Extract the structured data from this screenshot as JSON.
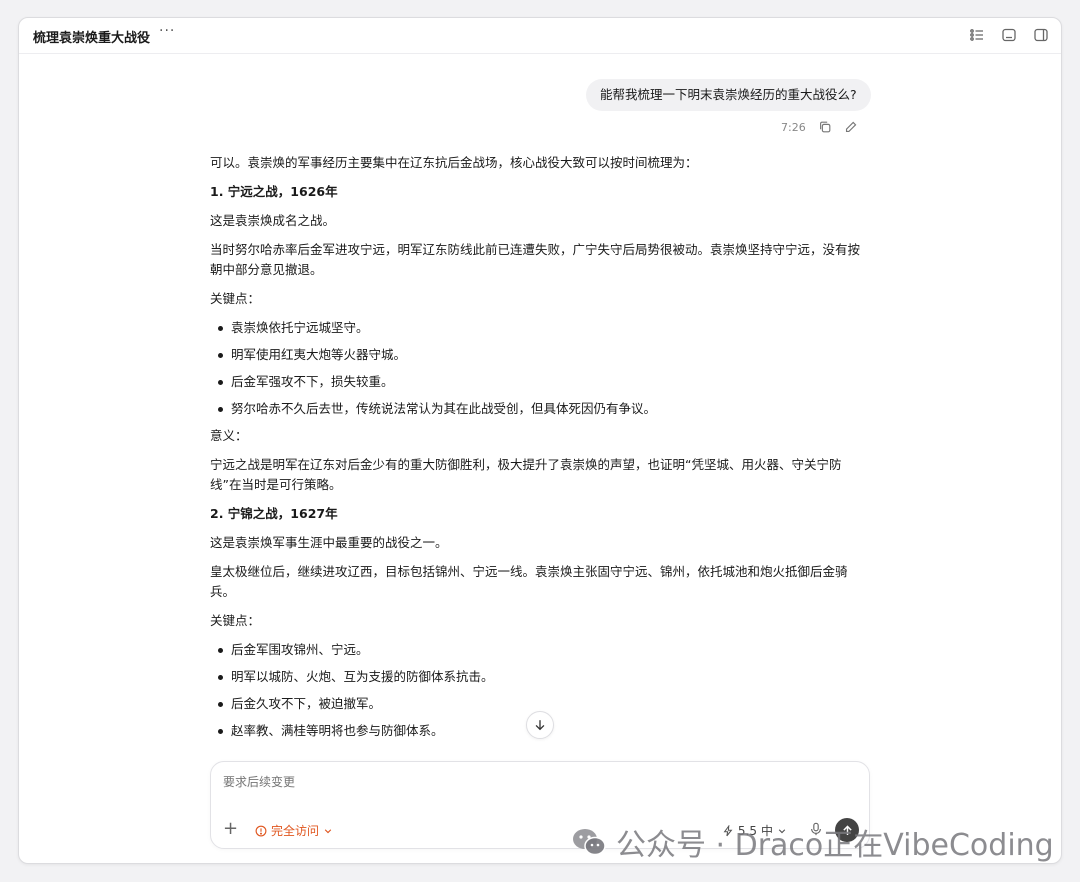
{
  "header": {
    "title": "梳理袁崇焕重大战役",
    "more": "···"
  },
  "user_message": {
    "text": "能帮我梳理一下明末袁崇焕经历的重大战役么?",
    "time": "7:26"
  },
  "answer": {
    "intro": "可以。袁崇焕的军事经历主要集中在辽东抗后金战场，核心战役大致可以按时间梳理为：",
    "battle1_title": "1. 宁远之战，1626年",
    "battle1_lead": "这是袁崇焕成名之战。",
    "battle1_desc": "当时努尔哈赤率后金军进攻宁远，明军辽东防线此前已连遭失败，广宁失守后局势很被动。袁崇焕坚持守宁远，没有按朝中部分意见撤退。",
    "keypoints_label": "关键点：",
    "battle1_points": [
      "袁崇焕依托宁远城坚守。",
      "明军使用红夷大炮等火器守城。",
      "后金军强攻不下，损失较重。",
      "努尔哈赤不久后去世，传统说法常认为其在此战受创，但具体死因仍有争议。"
    ],
    "meaning_label": "意义：",
    "battle1_meaning": "宁远之战是明军在辽东对后金少有的重大防御胜利，极大提升了袁崇焕的声望，也证明“凭坚城、用火器、守关宁防线”在当时是可行策略。",
    "battle2_title": "2. 宁锦之战，1627年",
    "battle2_lead": "这是袁崇焕军事生涯中最重要的战役之一。",
    "battle2_desc": "皇太极继位后，继续进攻辽西，目标包括锦州、宁远一线。袁崇焕主张固守宁远、锦州，依托城池和炮火抵御后金骑兵。",
    "battle2_points": [
      "后金军围攻锦州、宁远。",
      "明军以城防、火炮、互为支援的防御体系抗击。",
      "后金久攻不下，被迫撤军。",
      "赵率教、满桂等明将也参与防御体系。"
    ]
  },
  "composer": {
    "placeholder": "要求后续变更",
    "plus": "+",
    "access_label": "完全访问",
    "model_label": "5.5",
    "effort_label": "中"
  },
  "watermark": {
    "text": "公众号 · Draco正在VibeCoding"
  },
  "colors": {
    "accent_warning": "#e0561f",
    "bubble_bg": "#f1f1f3",
    "send_button": "#444444"
  },
  "icons": {
    "top_right": [
      "list-icon",
      "minimize-panel-icon",
      "sidebar-toggle-icon"
    ],
    "message_actions": [
      "copy-icon",
      "edit-icon"
    ],
    "composer": [
      "plus-icon",
      "warning-icon",
      "chevron-down-icon",
      "lightning-icon",
      "mic-icon",
      "arrow-up-icon"
    ]
  }
}
